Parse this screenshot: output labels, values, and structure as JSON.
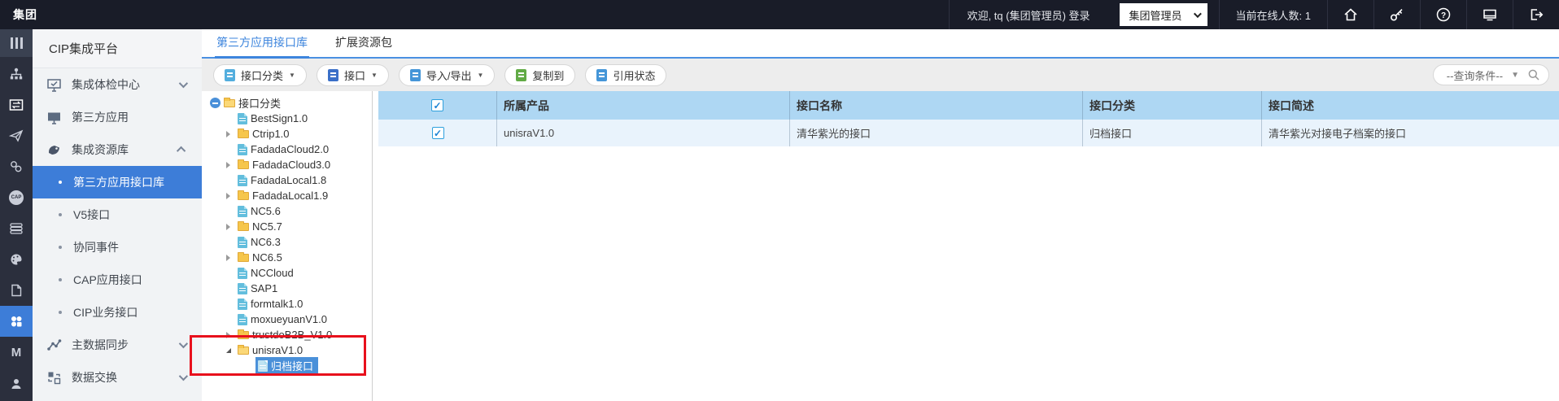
{
  "topbar": {
    "brand": "集团",
    "welcome": "欢迎, tq (集团管理员) 登录",
    "role_select": "集团管理员",
    "online_count": "当前在线人数: 1",
    "icons": [
      "home-icon",
      "key-icon",
      "help-icon",
      "monitor-icon",
      "logout-icon"
    ]
  },
  "rail": {
    "cap_label": "CAP",
    "m_label": "M",
    "icons": [
      "columns-icon",
      "org-chart-icon",
      "transfer-icon",
      "send-icon",
      "link-icon",
      "cap-icon",
      "layers-icon",
      "palette-icon",
      "document-icon",
      "apps-icon",
      "m-icon"
    ]
  },
  "sidebar": {
    "title": "CIP集成平台",
    "items": [
      {
        "label": "集成体检中心",
        "icon": "health-monitor-icon",
        "chevron": "down"
      },
      {
        "label": "第三方应用",
        "icon": "monitor-icon"
      },
      {
        "label": "集成资源库",
        "icon": "resource-icon",
        "chevron": "up"
      },
      {
        "label": "第三方应用接口库",
        "bullet": true,
        "selected": true
      },
      {
        "label": "V5接口",
        "bullet": true
      },
      {
        "label": "协同事件",
        "bullet": true
      },
      {
        "label": "CAP应用接口",
        "bullet": true
      },
      {
        "label": "CIP业务接口",
        "bullet": true
      },
      {
        "label": "主数据同步",
        "icon": "sync-icon",
        "chevron": "down"
      },
      {
        "label": "数据交换",
        "icon": "exchange-icon",
        "chevron": "down"
      }
    ]
  },
  "tabs": [
    {
      "label": "第三方应用接口库",
      "active": true
    },
    {
      "label": "扩展资源包",
      "active": false
    }
  ],
  "toolbar": {
    "buttons": [
      {
        "label": "接口分类",
        "dropdown": true,
        "icon_color": "#53aede"
      },
      {
        "label": "接口",
        "dropdown": true,
        "icon_color": "#3a6fc8"
      },
      {
        "label": "导入/导出",
        "dropdown": true,
        "icon_color": "#4596d8"
      },
      {
        "label": "复制到",
        "dropdown": false,
        "icon_color": "#62ab46"
      },
      {
        "label": "引用状态",
        "dropdown": false,
        "icon_color": "#4596d8"
      }
    ],
    "query_label": "--查询条件--"
  },
  "tree": {
    "root": "接口分类",
    "nodes": [
      {
        "label": "BestSign1.0",
        "type": "file"
      },
      {
        "label": "Ctrip1.0",
        "type": "folder"
      },
      {
        "label": "FadadaCloud2.0",
        "type": "file"
      },
      {
        "label": "FadadaCloud3.0",
        "type": "folder"
      },
      {
        "label": "FadadaLocal1.8",
        "type": "file"
      },
      {
        "label": "FadadaLocal1.9",
        "type": "folder"
      },
      {
        "label": "NC5.6",
        "type": "file"
      },
      {
        "label": "NC5.7",
        "type": "folder"
      },
      {
        "label": "NC6.3",
        "type": "file"
      },
      {
        "label": "NC6.5",
        "type": "folder"
      },
      {
        "label": "NCCloud",
        "type": "file"
      },
      {
        "label": "SAP1",
        "type": "file"
      },
      {
        "label": "formtalk1.0",
        "type": "file"
      },
      {
        "label": "moxueyuanV1.0",
        "type": "file"
      },
      {
        "label": "trustdoB2B_V1.0",
        "type": "folder"
      },
      {
        "label": "unisraV1.0",
        "type": "folder-open",
        "expanded": true
      },
      {
        "label": "归档接口",
        "type": "file",
        "selected": true,
        "level": 2
      }
    ]
  },
  "table": {
    "columns": [
      "所属产品",
      "接口名称",
      "接口分类",
      "接口简述"
    ],
    "rows": [
      {
        "checked": true,
        "cells": [
          "unisraV1.0",
          "清华紫光的接口",
          "归档接口",
          "清华紫光对接电子档案的接口"
        ]
      }
    ]
  },
  "colors": {
    "accent_blue": "#3d7dd8",
    "table_header": "#aed7f3",
    "row_selected": "#e9f3fc",
    "tree_selection": "#4a90d9",
    "annotation_red": "#e8101c"
  }
}
